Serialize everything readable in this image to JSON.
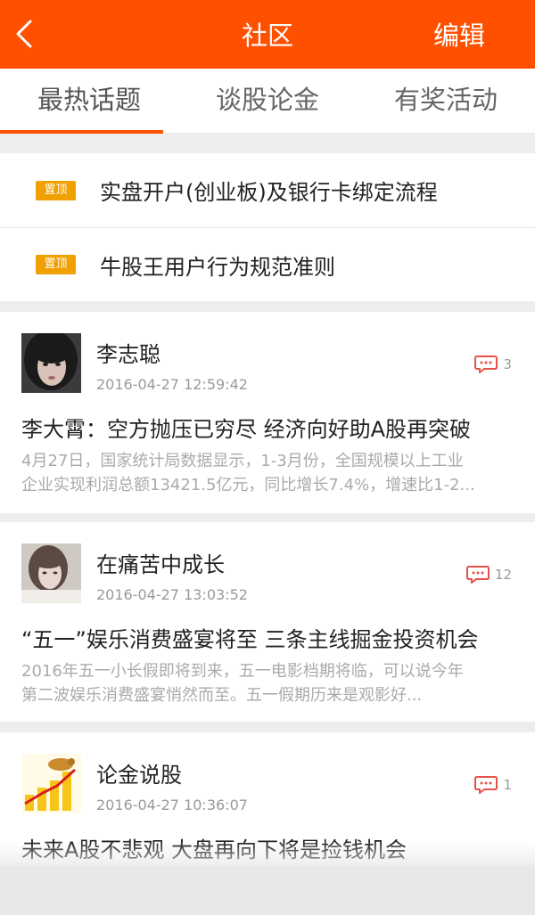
{
  "header": {
    "title": "社区",
    "edit_label": "编辑",
    "back_icon": "chevron-left-icon"
  },
  "tabs": [
    {
      "label": "最热话题",
      "active": true
    },
    {
      "label": "谈股论金",
      "active": false
    },
    {
      "label": "有奖活动",
      "active": false
    }
  ],
  "pinned": [
    {
      "badge": "置顶",
      "text": "实盘开户(创业板)及银行卡绑定流程"
    },
    {
      "badge": "置顶",
      "text": "牛股王用户行为规范准则"
    }
  ],
  "posts": [
    {
      "author": "李志聪",
      "time": "2016-04-27 12:59:42",
      "comments": "3",
      "title": "李大霄：空方抛压已穷尽 经济向好助A股再突破",
      "summary_line1": "4月27日，国家统计局数据显示，1-3月份，全国规模以上工业",
      "summary_line2": "企业实现利润总额13421.5亿元，同比增长7.4%，增速比1-2..."
    },
    {
      "author": "在痛苦中成长",
      "time": "2016-04-27 13:03:52",
      "comments": "12",
      "title": "“五一”娱乐消费盛宴将至 三条主线掘金投资机会",
      "summary_line1": "2016年五一小长假即将到来，五一电影档期将临，可以说今年",
      "summary_line2": "第二波娱乐消费盛宴悄然而至。五一假期历来是观影好..."
    },
    {
      "author": "论金说股",
      "time": "2016-04-27 10:36:07",
      "comments": "1",
      "title": "未来A股不悲观 大盘再向下将是捡钱机会"
    }
  ],
  "colors": {
    "brand": "#ff5000",
    "pin_badge": "#f0a000",
    "comment_icon": "#e4524a"
  }
}
